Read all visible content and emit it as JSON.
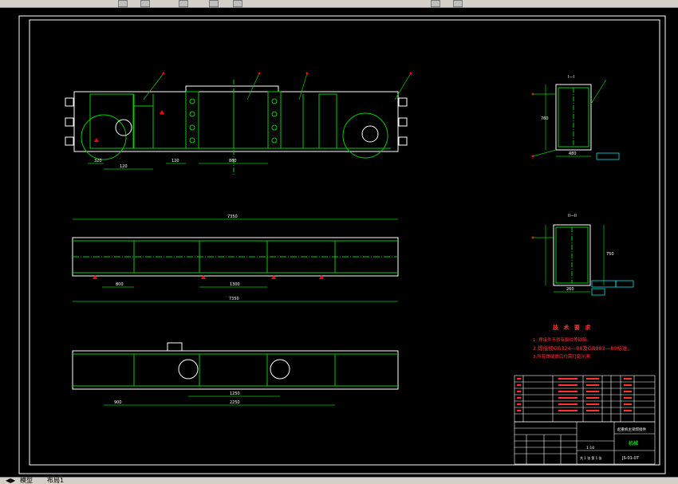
{
  "notes": {
    "title": "技 术 要 求",
    "items": [
      "1. 焊接件不得有裂纹等缺陷。",
      "2.焊接按GB324—88及GB983—80标准。",
      "3.所有焊缝焊后均需打磨光滑。"
    ]
  },
  "views": {
    "section1": "I—I",
    "section2": "II—II"
  },
  "dims": {
    "top_1": "320",
    "top_2": "120",
    "top_3": "120",
    "top_4": "880",
    "mid_overall": "7350",
    "mid_1": "800",
    "mid_2": "1300",
    "mid_3": "7350",
    "bot_1": "900",
    "bot_2": "1250",
    "bot_3": "2250",
    "sec_w": "480",
    "sec_h": "760",
    "sec2_w": "260",
    "sec2_h": "750"
  },
  "title_block": {
    "drawing_name": "起重机主梁焊接件",
    "drawing_no": "JS-01-07",
    "company": "机械",
    "scale": "1:10",
    "sheet": "共 1 张 第 1 张"
  },
  "tabs": [
    "模型",
    "布局1"
  ],
  "colors": {
    "frame": "#ffffff",
    "green": "#00cc00",
    "red": "#ff0000",
    "cyan": "#00ffff",
    "notes": "#ff3333"
  }
}
